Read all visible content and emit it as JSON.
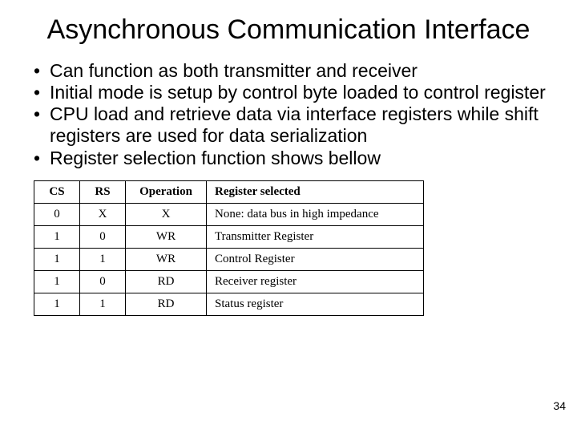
{
  "title": "Asynchronous Communication Interface",
  "bullets": [
    "Can function as both transmitter and receiver",
    "Initial mode is setup by control byte loaded to control register",
    "CPU load and retrieve data via interface registers while shift registers are used for data serialization",
    "Register selection function shows bellow"
  ],
  "table": {
    "headers": {
      "cs": "CS",
      "rs": "RS",
      "op": "Operation",
      "sel": "Register selected"
    },
    "rows": [
      {
        "cs": "0",
        "rs": "X",
        "op": "X",
        "sel": "None: data bus in high impedance"
      },
      {
        "cs": "1",
        "rs": "0",
        "op": "WR",
        "sel": "Transmitter Register"
      },
      {
        "cs": "1",
        "rs": "1",
        "op": "WR",
        "sel": "Control Register"
      },
      {
        "cs": "1",
        "rs": "0",
        "op": "RD",
        "sel": "Receiver register"
      },
      {
        "cs": "1",
        "rs": "1",
        "op": "RD",
        "sel": "Status register"
      }
    ]
  },
  "page_number": "34"
}
